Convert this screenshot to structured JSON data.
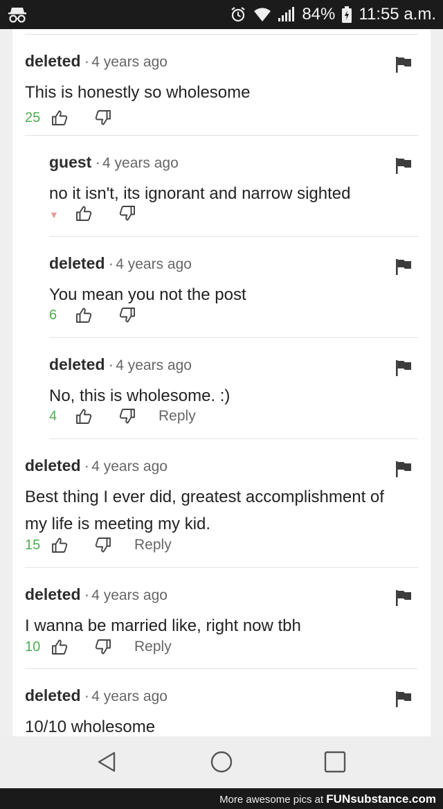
{
  "status_bar": {
    "battery": "84%",
    "time": "11:55 a.m."
  },
  "comments": [
    {
      "author": "deleted",
      "age": "4 years ago",
      "text": "This is honestly so wholesome",
      "score": "25",
      "reply": ""
    },
    {
      "author": "guest",
      "age": "4 years ago",
      "text": "no it isn't, its ignorant and narrow sighted",
      "score": "",
      "reply": ""
    },
    {
      "author": "deleted",
      "age": "4 years ago",
      "text": "You mean you not the post",
      "score": "6",
      "reply": ""
    },
    {
      "author": "deleted",
      "age": "4 years ago",
      "text": "No, this is wholesome. :)",
      "score": "4",
      "reply": "Reply"
    },
    {
      "author": "deleted",
      "age": "4 years ago",
      "text": "Best thing I ever did, greatest accomplishment of my life is meeting my kid.",
      "score": "15",
      "reply": "Reply"
    },
    {
      "author": "deleted",
      "age": "4 years ago",
      "text": "I wanna be married like, right now tbh",
      "score": "10",
      "reply": "Reply"
    },
    {
      "author": "deleted",
      "age": "4 years ago",
      "text": "10/10 wholesome",
      "score": "",
      "reply": ""
    }
  ],
  "watermark": {
    "prefix": "More awesome pics at",
    "brand": "FUNsubstance.com"
  },
  "icons": {
    "flag": "flag-icon",
    "upvote": "thumbs-up-icon",
    "downvote": "thumbs-down-icon",
    "collapse": "triangle-down-icon",
    "nav_back": "back-triangle-icon",
    "nav_home": "home-circle-icon",
    "nav_recents": "recents-square-icon"
  },
  "colors": {
    "score": "#4caf50",
    "collapse_arrow": "#e79b94",
    "status_bar": "#1b1b1b",
    "card": "#ffffff",
    "page": "#efefef"
  }
}
